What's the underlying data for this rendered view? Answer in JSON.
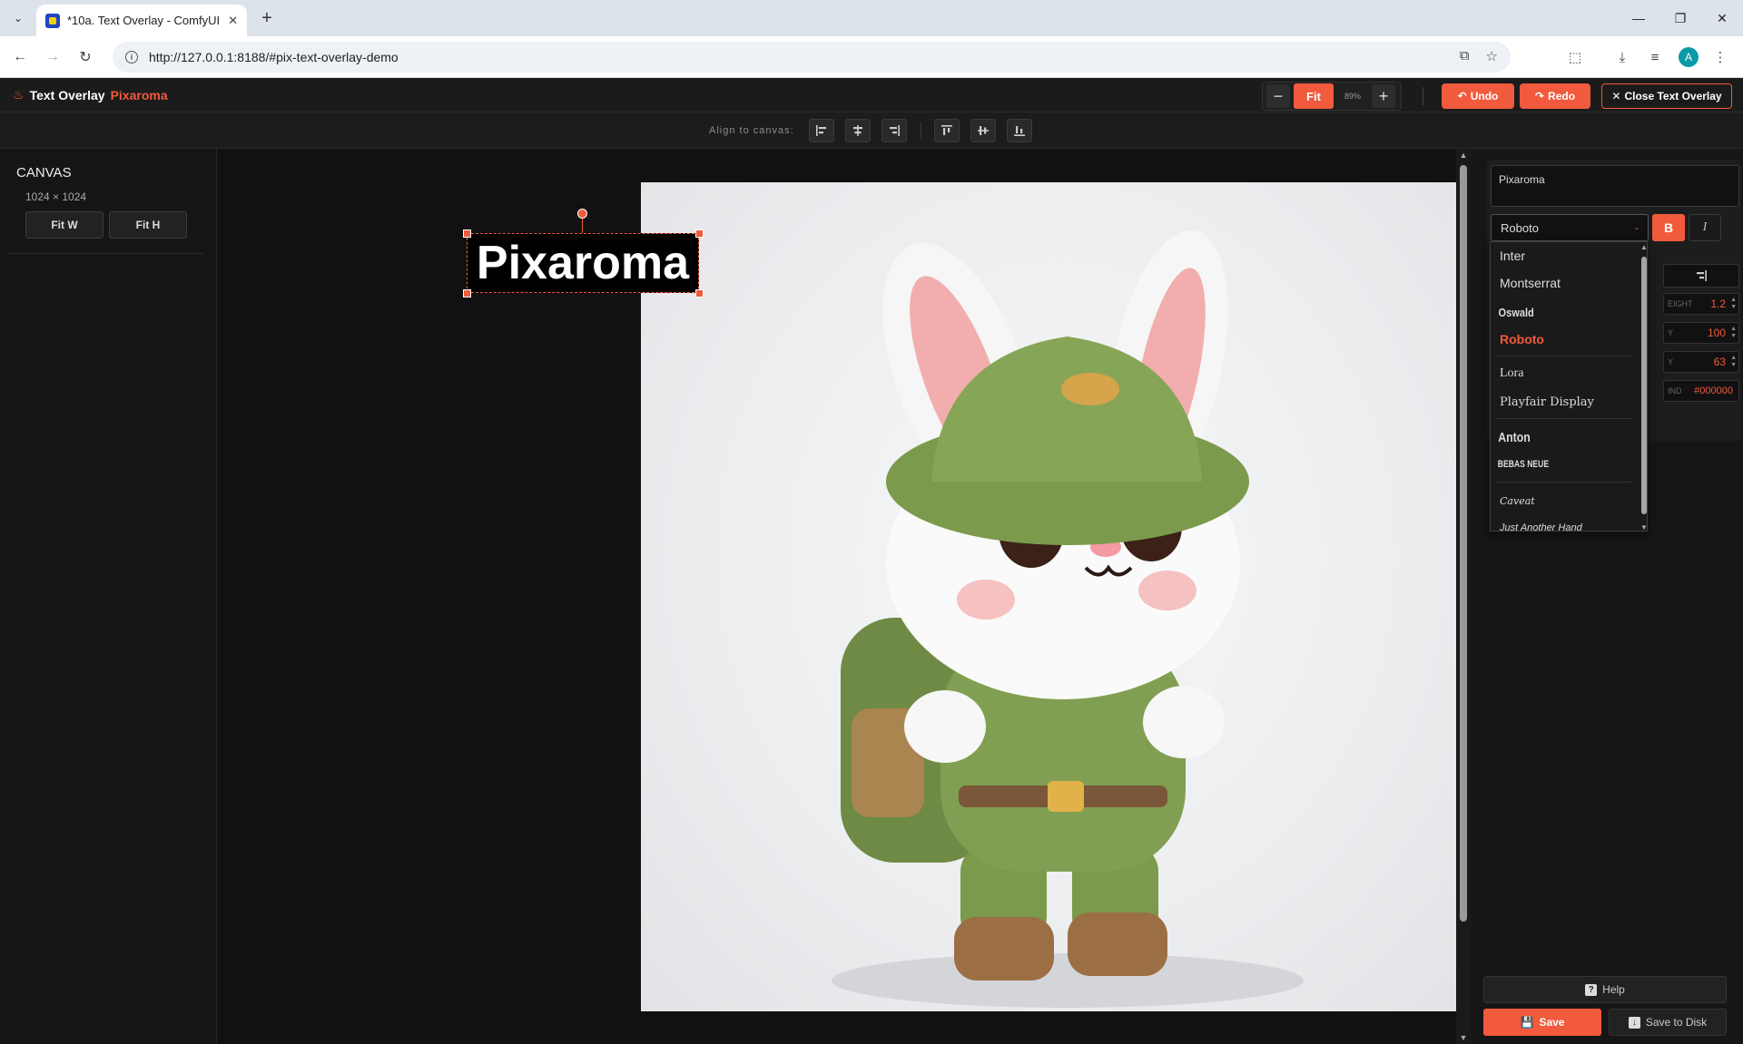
{
  "browser": {
    "tab_title": "*10a. Text Overlay - ComfyUI",
    "url": "http://127.0.0.1:8188/#pix-text-overlay-demo",
    "profile_initial": "A"
  },
  "header": {
    "brand_name": "Text Overlay",
    "brand_accent": "Pixaroma",
    "fit_label": "Fit",
    "zoom_value": "89%",
    "undo_label": "Undo",
    "redo_label": "Redo",
    "close_label": "Close Text Overlay"
  },
  "align_bar": {
    "label": "Align to canvas:"
  },
  "left_panel": {
    "title": "CANVAS",
    "size": "1024 × 1024",
    "fit_w": "Fit W",
    "fit_h": "Fit H"
  },
  "canvas": {
    "overlay_text": "Pixaroma"
  },
  "right_panel": {
    "text_value": "Pixaroma",
    "font_selected": "Roboto",
    "bold_label": "B",
    "italic_label": "I",
    "line_height_label": "EIGHT",
    "line_height_value": "1.2",
    "x_label": "Y",
    "x_value": "100",
    "y_label": "Y",
    "y_value": "63",
    "bg_label": "IND",
    "bg_value": "#000000",
    "help_label": "Help",
    "save_label": "Save",
    "save_disk_label": "Save to Disk"
  },
  "font_dropdown": {
    "options": [
      "Inter",
      "Montserrat",
      "Oswald",
      "Roboto",
      "Lora",
      "Playfair Display",
      "Anton",
      "BEBAS NEUE",
      "Caveat",
      "Just Another Hand"
    ],
    "selected": "Roboto"
  },
  "colors": {
    "accent": "#f15a3c",
    "panel": "#1b1b1b",
    "background": "#111111"
  }
}
